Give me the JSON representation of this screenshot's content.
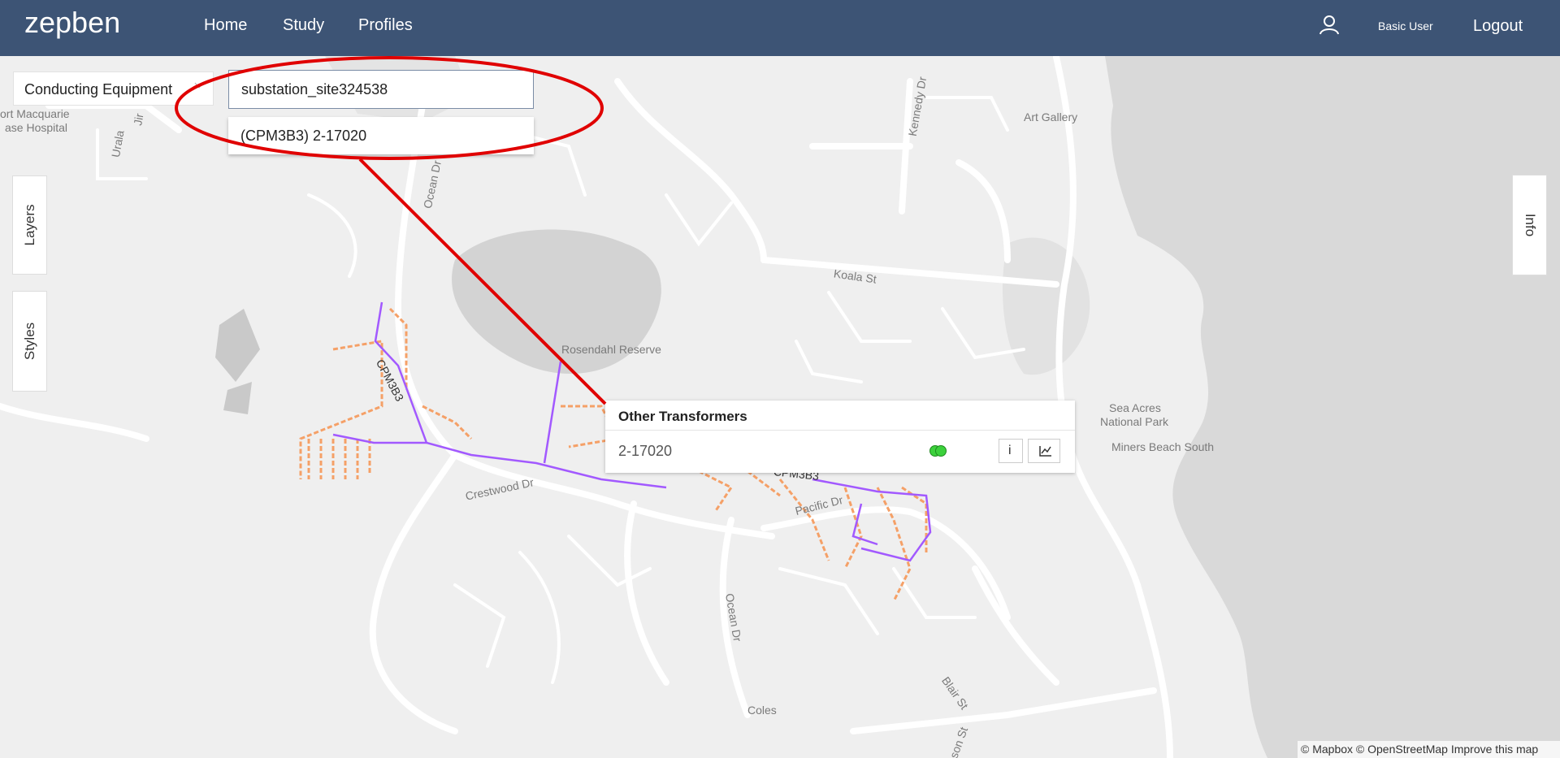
{
  "navbar": {
    "logo_text": "zepben",
    "links": [
      "Home",
      "Study",
      "Profiles"
    ],
    "user_name": "Basic User",
    "logout_label": "Logout"
  },
  "search": {
    "equipment_type": "Conducting Equipment",
    "query": "substation_site324538",
    "suggestion": "(CPM3B3) 2-17020"
  },
  "side_tabs": {
    "layers": "Layers",
    "styles": "Styles",
    "info": "Info"
  },
  "popup": {
    "title": "Other Transformers",
    "item_name": "2-17020",
    "info_button": "i",
    "status_color": "#3cd13c"
  },
  "map_labels": {
    "hospital_line1": "ort Macquarie",
    "hospital_line2": "ase Hospital",
    "urala": "Urala",
    "jir": "Jir",
    "ocean_dr_north": "Ocean Dr",
    "kennedy_dr": "Kennedy Dr",
    "art_gallery": "Art Gallery",
    "koala_st": "Koala St",
    "rosendahl": "Rosendahl Reserve",
    "cpm3b3_west": "CPM3B3",
    "cpm3b3_east": "CPM3B3",
    "crestwood": "Crestwood Dr",
    "pacific": "Pacific Dr",
    "sea_acres_line1": "Sea Acres",
    "sea_acres_line2": "National Park",
    "miners_beach": "Miners Beach South",
    "ocean_dr_south": "Ocean Dr",
    "blair_st": "Blair St",
    "coles": "Coles",
    "son_st": "son St"
  },
  "attribution": "© Mapbox © OpenStreetMap Improve this map",
  "colors": {
    "navbar": "#3d5475",
    "feeder_line": "#a259ff",
    "lv_network": "#f5a067",
    "annotation": "#e00000"
  }
}
